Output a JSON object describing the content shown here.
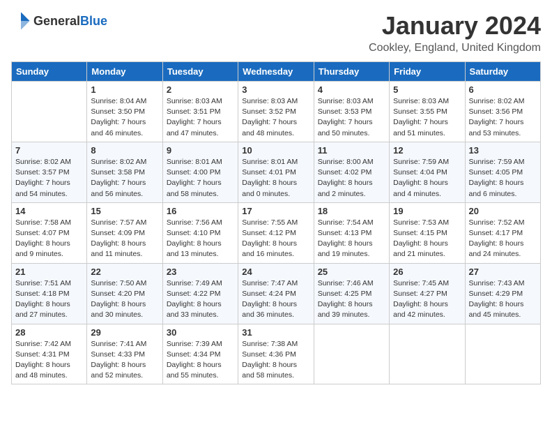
{
  "header": {
    "logo_general": "General",
    "logo_blue": "Blue",
    "month_title": "January 2024",
    "location": "Cookley, England, United Kingdom"
  },
  "days_of_week": [
    "Sunday",
    "Monday",
    "Tuesday",
    "Wednesday",
    "Thursday",
    "Friday",
    "Saturday"
  ],
  "weeks": [
    [
      {
        "day": "",
        "sunrise": "",
        "sunset": "",
        "daylight": ""
      },
      {
        "day": "1",
        "sunrise": "Sunrise: 8:04 AM",
        "sunset": "Sunset: 3:50 PM",
        "daylight": "Daylight: 7 hours and 46 minutes."
      },
      {
        "day": "2",
        "sunrise": "Sunrise: 8:03 AM",
        "sunset": "Sunset: 3:51 PM",
        "daylight": "Daylight: 7 hours and 47 minutes."
      },
      {
        "day": "3",
        "sunrise": "Sunrise: 8:03 AM",
        "sunset": "Sunset: 3:52 PM",
        "daylight": "Daylight: 7 hours and 48 minutes."
      },
      {
        "day": "4",
        "sunrise": "Sunrise: 8:03 AM",
        "sunset": "Sunset: 3:53 PM",
        "daylight": "Daylight: 7 hours and 50 minutes."
      },
      {
        "day": "5",
        "sunrise": "Sunrise: 8:03 AM",
        "sunset": "Sunset: 3:55 PM",
        "daylight": "Daylight: 7 hours and 51 minutes."
      },
      {
        "day": "6",
        "sunrise": "Sunrise: 8:02 AM",
        "sunset": "Sunset: 3:56 PM",
        "daylight": "Daylight: 7 hours and 53 minutes."
      }
    ],
    [
      {
        "day": "7",
        "sunrise": "Sunrise: 8:02 AM",
        "sunset": "Sunset: 3:57 PM",
        "daylight": "Daylight: 7 hours and 54 minutes."
      },
      {
        "day": "8",
        "sunrise": "Sunrise: 8:02 AM",
        "sunset": "Sunset: 3:58 PM",
        "daylight": "Daylight: 7 hours and 56 minutes."
      },
      {
        "day": "9",
        "sunrise": "Sunrise: 8:01 AM",
        "sunset": "Sunset: 4:00 PM",
        "daylight": "Daylight: 7 hours and 58 minutes."
      },
      {
        "day": "10",
        "sunrise": "Sunrise: 8:01 AM",
        "sunset": "Sunset: 4:01 PM",
        "daylight": "Daylight: 8 hours and 0 minutes."
      },
      {
        "day": "11",
        "sunrise": "Sunrise: 8:00 AM",
        "sunset": "Sunset: 4:02 PM",
        "daylight": "Daylight: 8 hours and 2 minutes."
      },
      {
        "day": "12",
        "sunrise": "Sunrise: 7:59 AM",
        "sunset": "Sunset: 4:04 PM",
        "daylight": "Daylight: 8 hours and 4 minutes."
      },
      {
        "day": "13",
        "sunrise": "Sunrise: 7:59 AM",
        "sunset": "Sunset: 4:05 PM",
        "daylight": "Daylight: 8 hours and 6 minutes."
      }
    ],
    [
      {
        "day": "14",
        "sunrise": "Sunrise: 7:58 AM",
        "sunset": "Sunset: 4:07 PM",
        "daylight": "Daylight: 8 hours and 9 minutes."
      },
      {
        "day": "15",
        "sunrise": "Sunrise: 7:57 AM",
        "sunset": "Sunset: 4:09 PM",
        "daylight": "Daylight: 8 hours and 11 minutes."
      },
      {
        "day": "16",
        "sunrise": "Sunrise: 7:56 AM",
        "sunset": "Sunset: 4:10 PM",
        "daylight": "Daylight: 8 hours and 13 minutes."
      },
      {
        "day": "17",
        "sunrise": "Sunrise: 7:55 AM",
        "sunset": "Sunset: 4:12 PM",
        "daylight": "Daylight: 8 hours and 16 minutes."
      },
      {
        "day": "18",
        "sunrise": "Sunrise: 7:54 AM",
        "sunset": "Sunset: 4:13 PM",
        "daylight": "Daylight: 8 hours and 19 minutes."
      },
      {
        "day": "19",
        "sunrise": "Sunrise: 7:53 AM",
        "sunset": "Sunset: 4:15 PM",
        "daylight": "Daylight: 8 hours and 21 minutes."
      },
      {
        "day": "20",
        "sunrise": "Sunrise: 7:52 AM",
        "sunset": "Sunset: 4:17 PM",
        "daylight": "Daylight: 8 hours and 24 minutes."
      }
    ],
    [
      {
        "day": "21",
        "sunrise": "Sunrise: 7:51 AM",
        "sunset": "Sunset: 4:18 PM",
        "daylight": "Daylight: 8 hours and 27 minutes."
      },
      {
        "day": "22",
        "sunrise": "Sunrise: 7:50 AM",
        "sunset": "Sunset: 4:20 PM",
        "daylight": "Daylight: 8 hours and 30 minutes."
      },
      {
        "day": "23",
        "sunrise": "Sunrise: 7:49 AM",
        "sunset": "Sunset: 4:22 PM",
        "daylight": "Daylight: 8 hours and 33 minutes."
      },
      {
        "day": "24",
        "sunrise": "Sunrise: 7:47 AM",
        "sunset": "Sunset: 4:24 PM",
        "daylight": "Daylight: 8 hours and 36 minutes."
      },
      {
        "day": "25",
        "sunrise": "Sunrise: 7:46 AM",
        "sunset": "Sunset: 4:25 PM",
        "daylight": "Daylight: 8 hours and 39 minutes."
      },
      {
        "day": "26",
        "sunrise": "Sunrise: 7:45 AM",
        "sunset": "Sunset: 4:27 PM",
        "daylight": "Daylight: 8 hours and 42 minutes."
      },
      {
        "day": "27",
        "sunrise": "Sunrise: 7:43 AM",
        "sunset": "Sunset: 4:29 PM",
        "daylight": "Daylight: 8 hours and 45 minutes."
      }
    ],
    [
      {
        "day": "28",
        "sunrise": "Sunrise: 7:42 AM",
        "sunset": "Sunset: 4:31 PM",
        "daylight": "Daylight: 8 hours and 48 minutes."
      },
      {
        "day": "29",
        "sunrise": "Sunrise: 7:41 AM",
        "sunset": "Sunset: 4:33 PM",
        "daylight": "Daylight: 8 hours and 52 minutes."
      },
      {
        "day": "30",
        "sunrise": "Sunrise: 7:39 AM",
        "sunset": "Sunset: 4:34 PM",
        "daylight": "Daylight: 8 hours and 55 minutes."
      },
      {
        "day": "31",
        "sunrise": "Sunrise: 7:38 AM",
        "sunset": "Sunset: 4:36 PM",
        "daylight": "Daylight: 8 hours and 58 minutes."
      },
      {
        "day": "",
        "sunrise": "",
        "sunset": "",
        "daylight": ""
      },
      {
        "day": "",
        "sunrise": "",
        "sunset": "",
        "daylight": ""
      },
      {
        "day": "",
        "sunrise": "",
        "sunset": "",
        "daylight": ""
      }
    ]
  ]
}
